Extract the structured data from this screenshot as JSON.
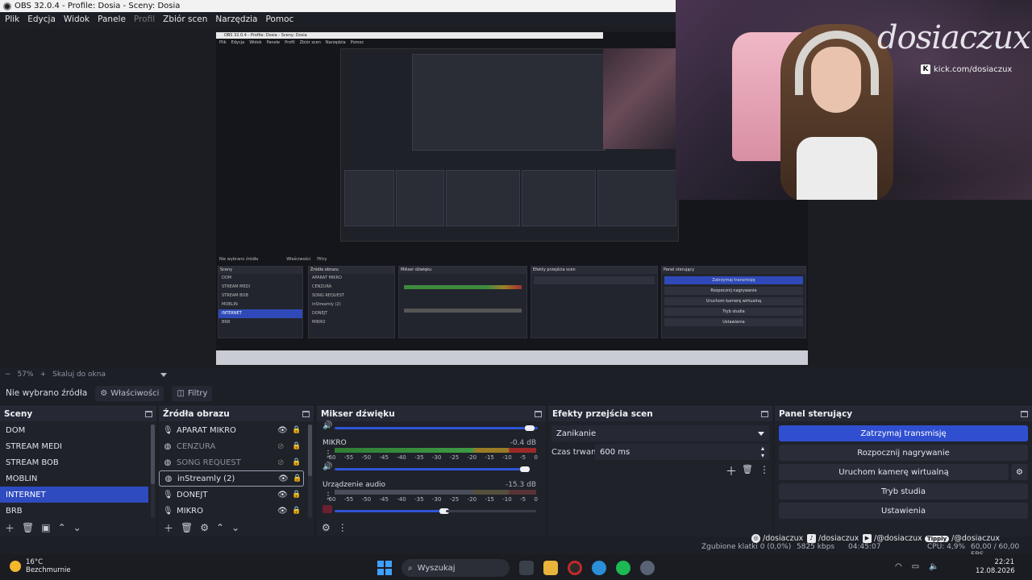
{
  "window": {
    "title": "OBS 32.0.4 - Profile: Dosia - Sceny: Dosia"
  },
  "menu": {
    "items": [
      "Plik",
      "Edycja",
      "Widok",
      "Panele",
      "Profil",
      "Zbiór scen",
      "Narzędzia",
      "Pomoc"
    ]
  },
  "preview": {
    "zoom": "57%",
    "scale_mode": "Skaluj do okna",
    "nested": {
      "title": "OBS 32.0.4 - Profile: Dosia - Sceny: Dosia",
      "menu": [
        "Plik",
        "Edycja",
        "Widok",
        "Panele",
        "Profil",
        "Zbiór scen",
        "Narzędzia",
        "Pomoc"
      ],
      "no_source": "Nie wybrano źródła",
      "props": "Właściwości",
      "filters": "Filtry",
      "scenes_title": "Sceny",
      "scenes": [
        "DOM",
        "STREAM MEDI",
        "STREAM BOB",
        "MOBLIN",
        "INTERNET",
        "BRB"
      ],
      "sources_title": "Źródła obrazu",
      "sources": [
        "APARAT MIKRO",
        "CENZURA",
        "SONG REQUEST",
        "inStreamly (2)",
        "DONEJT",
        "MIKRO"
      ],
      "mixer_title": "Mikser dźwięku",
      "transitions_title": "Efekty przejścia scen",
      "controls_title": "Panel sterujący",
      "controls": [
        "Zatrzymaj transmisję",
        "Rozpocznij nagrywanie",
        "Uruchom kamerę wirtualną",
        "Tryb studia",
        "Ustawienia"
      ]
    }
  },
  "webcam": {
    "logo": "dosiaczux",
    "kick": "kick.com/dosiaczux"
  },
  "propbar": {
    "no_source": "Nie wybrano źródła",
    "properties": "Właściwości",
    "filters": "Filtry"
  },
  "scenes": {
    "title": "Sceny",
    "items": [
      "DOM",
      "STREAM MEDI",
      "STREAM BOB",
      "MOBLIN",
      "INTERNET",
      "BRB"
    ],
    "selected": "INTERNET"
  },
  "sources": {
    "title": "Źródła obrazu",
    "items": [
      {
        "name": "APARAT MIKRO",
        "icon": "microphone-icon",
        "visible": true,
        "dim": false
      },
      {
        "name": "CENZURA",
        "icon": "globe-icon",
        "visible": false,
        "dim": true
      },
      {
        "name": "SONG REQUEST",
        "icon": "globe-icon",
        "visible": false,
        "dim": true
      },
      {
        "name": "inStreamly (2)",
        "icon": "globe-icon",
        "visible": true,
        "dim": false
      },
      {
        "name": "DONEJT",
        "icon": "microphone-icon",
        "visible": true,
        "dim": false
      },
      {
        "name": "MIKRO",
        "icon": "microphone-icon",
        "visible": true,
        "dim": false
      }
    ]
  },
  "mixer": {
    "title": "Mikser dźwięku",
    "channels": [
      {
        "name": "MIKRO",
        "db": "-0.4 dB"
      },
      {
        "name": "Urządzenie audio",
        "db": "-15.3 dB"
      }
    ],
    "ticks": [
      "-60",
      "-55",
      "-50",
      "-45",
      "-40",
      "-35",
      "-30",
      "-25",
      "-20",
      "-15",
      "-10",
      "-5",
      "0"
    ]
  },
  "transitions": {
    "title": "Efekty przejścia scen",
    "selected": "Zanikanie",
    "duration_label": "Czas trwania",
    "duration": "600 ms"
  },
  "controls": {
    "title": "Panel sterujący",
    "stop_stream": "Zatrzymaj transmisję",
    "start_record": "Rozpocznij nagrywanie",
    "virtual_cam": "Uruchom kamerę wirtualną",
    "studio_mode": "Tryb studia",
    "settings": "Ustawienia"
  },
  "socials": [
    {
      "icon": "instagram-icon",
      "handle": "/dosiaczux"
    },
    {
      "icon": "tiktok-icon",
      "handle": "/dosiaczux"
    },
    {
      "icon": "youtube-icon",
      "handle": "/@dosiaczux"
    },
    {
      "icon": "tipply-icon",
      "label": "Tipply",
      "handle": "/@dosiaczux"
    }
  ],
  "status": {
    "dropped": "Zgubione klatki 0 (0,0%)",
    "bitrate": "5825 kbps",
    "uptime": "04:45:07",
    "cpu": "CPU: 4,9%",
    "fps": "60,00 / 60,00 FPS"
  },
  "taskbar": {
    "temp": "16°C",
    "weather": "Bezchmurnie",
    "search_placeholder": "Wyszukaj",
    "time": "22:21",
    "date": "12.08.2026"
  },
  "colors": {
    "accent": "#2f4fd0",
    "panel": "#1f2229",
    "header": "#262933"
  }
}
